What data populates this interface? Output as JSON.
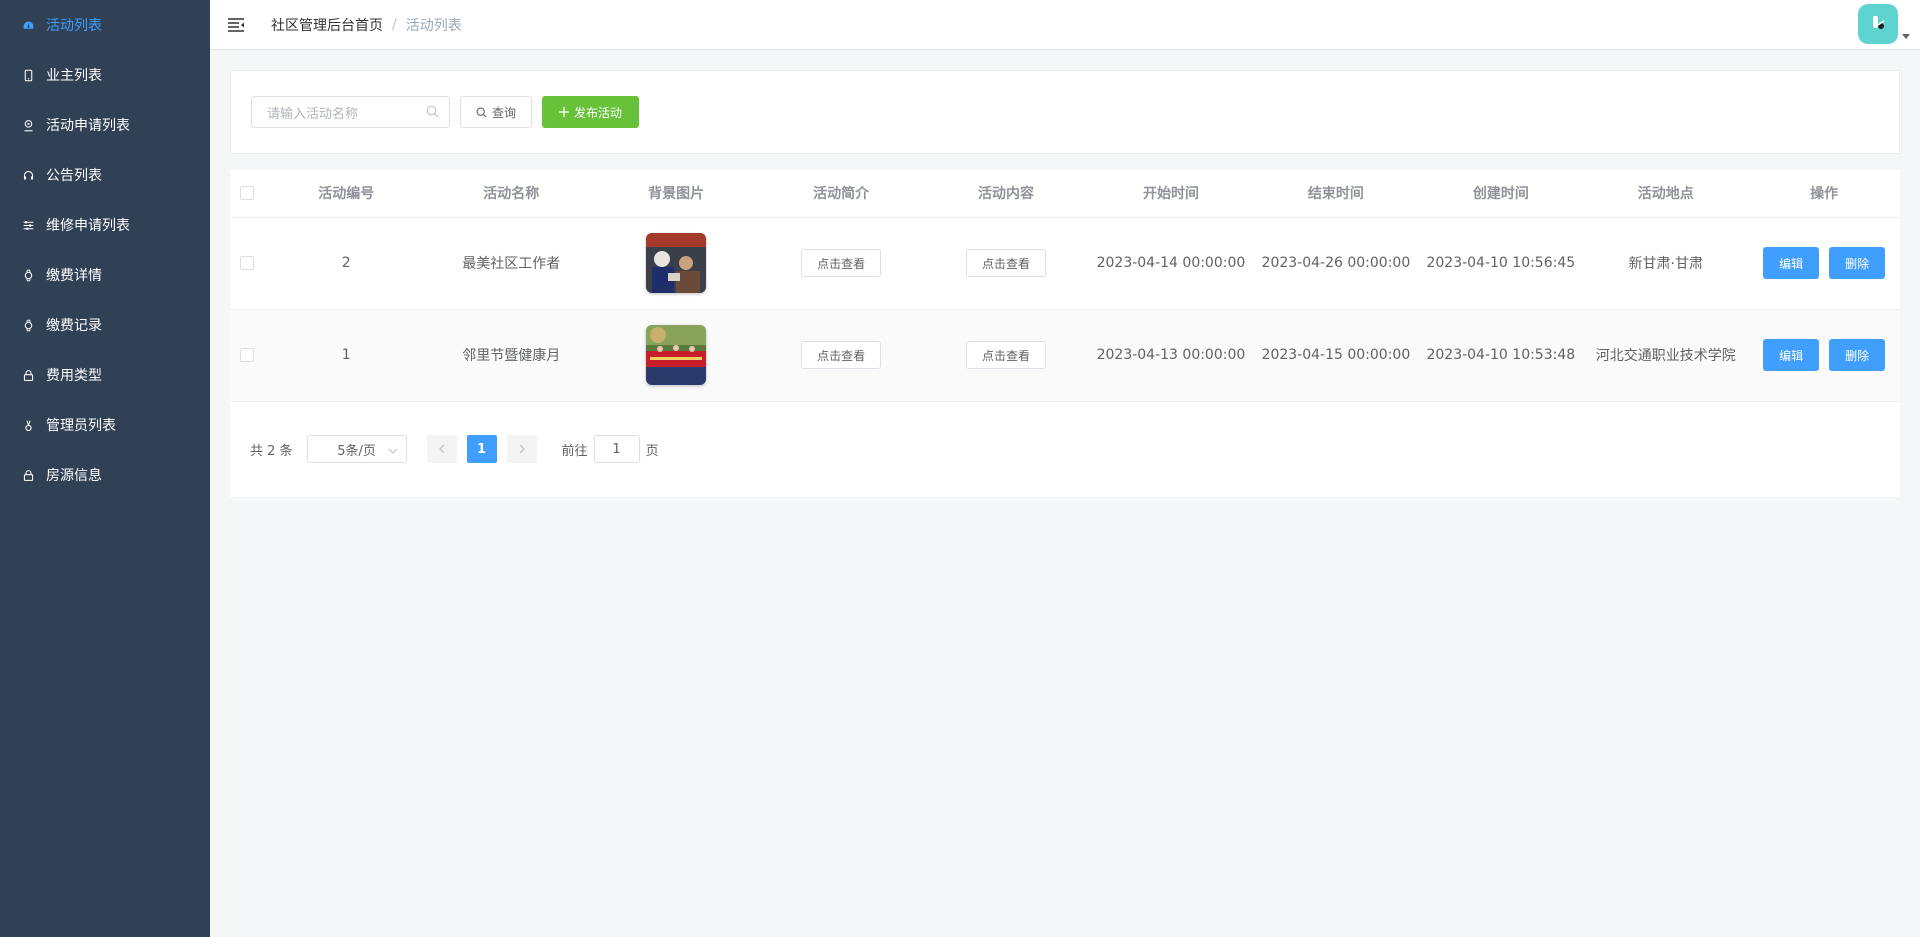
{
  "sidebar": {
    "items": [
      {
        "label": "活动列表",
        "icon": "dashboard-icon"
      },
      {
        "label": "业主列表",
        "icon": "phone-icon"
      },
      {
        "label": "活动申请列表",
        "icon": "user-badge-icon"
      },
      {
        "label": "公告列表",
        "icon": "headset-icon"
      },
      {
        "label": "维修申请列表",
        "icon": "sliders-icon"
      },
      {
        "label": "缴费详情",
        "icon": "watch-icon"
      },
      {
        "label": "缴费记录",
        "icon": "watch-icon"
      },
      {
        "label": "费用类型",
        "icon": "lock-icon"
      },
      {
        "label": "管理员列表",
        "icon": "medal-icon"
      },
      {
        "label": "房源信息",
        "icon": "lock-icon"
      }
    ]
  },
  "header": {
    "breadcrumb_home": "社区管理后台首页",
    "breadcrumb_sep": "/",
    "breadcrumb_current": "活动列表"
  },
  "search": {
    "placeholder": "请输入活动名称",
    "query_label": "查询",
    "publish_label": "发布活动"
  },
  "table": {
    "headers": [
      "活动编号",
      "活动名称",
      "背景图片",
      "活动简介",
      "活动内容",
      "开始时间",
      "结束时间",
      "创建时间",
      "活动地点",
      "操作"
    ],
    "view_label": "点击查看",
    "edit_label": "编辑",
    "delete_label": "删除",
    "rows": [
      {
        "id": "2",
        "name": "最美社区工作者",
        "start": "2023-04-14 00:00:00",
        "end": "2023-04-26 00:00:00",
        "created": "2023-04-10 10:56:45",
        "place": "新甘肃·甘肃"
      },
      {
        "id": "1",
        "name": "邻里节暨健康月",
        "start": "2023-04-13 00:00:00",
        "end": "2023-04-15 00:00:00",
        "created": "2023-04-10 10:53:48",
        "place": "河北交通职业技术学院"
      }
    ]
  },
  "pagination": {
    "total": "共 2 条",
    "page_size": "5条/页",
    "current_page": "1",
    "goto_prefix": "前往",
    "goto_value": "1",
    "goto_suffix": "页"
  },
  "colors": {
    "sidebar_bg": "#304156",
    "accent": "#409eff",
    "success": "#67c23a",
    "avatar_bg": "#5ed3cf"
  }
}
